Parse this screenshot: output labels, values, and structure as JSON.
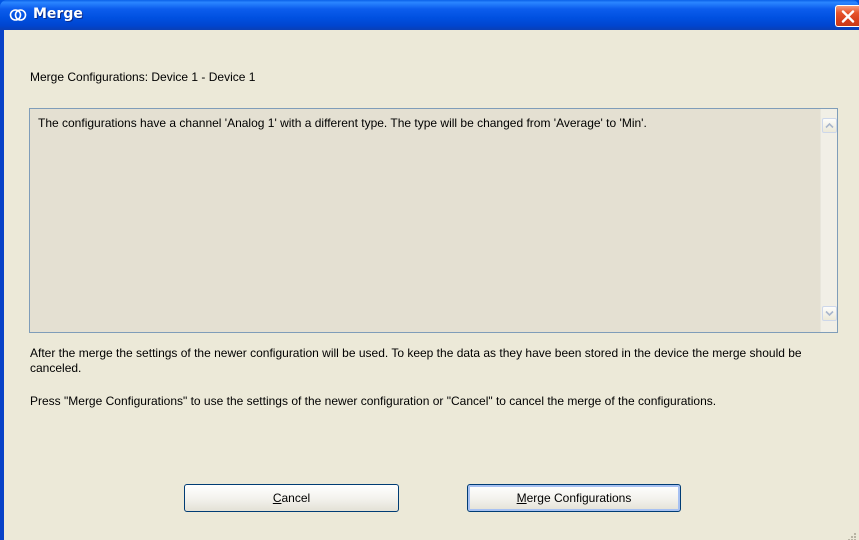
{
  "window": {
    "title": "Merge"
  },
  "dialog": {
    "header": "Merge Configurations: Device 1 - Device 1",
    "message": "The configurations have a channel 'Analog 1' with a different type. The type will be changed from 'Average' to 'Min'.",
    "paragraph1": "After the merge the settings of the newer configuration will be used. To keep the data as they have been stored in the device the merge should be canceled.",
    "paragraph2": "Press \"Merge Configurations\" to use the settings of the newer configuration or \"Cancel\" to cancel the merge of the configurations."
  },
  "buttons": {
    "cancel": {
      "mnemonic": "C",
      "rest": "ancel"
    },
    "merge": {
      "mnemonic": "M",
      "rest": "erge Configurations"
    }
  },
  "icons": {
    "title": "merge-rings-icon",
    "close": "close-x-icon",
    "scroll_up": "scroll-up-arrow-icon",
    "scroll_down": "scroll-down-arrow-icon",
    "resize": "resize-grip-icon"
  },
  "colors": {
    "titlebar": "#0054e3",
    "close": "#d7401e",
    "dialog_bg": "#ece9d8",
    "message_bg": "#e4e0d2",
    "button_border": "#003c74"
  }
}
